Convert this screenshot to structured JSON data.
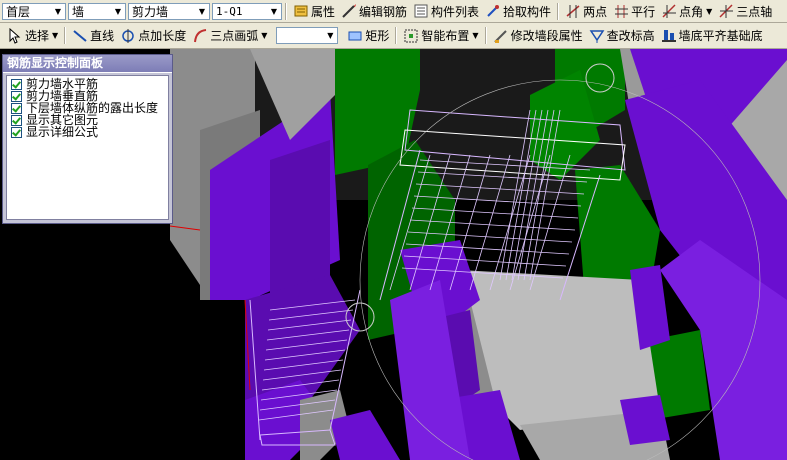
{
  "toolbar1": {
    "floor_select": "首层",
    "type_select": "墙",
    "subtype_select": "剪力墙",
    "element_select": "1-Q1",
    "buttons": [
      "属性",
      "编辑钢筋",
      "构件列表",
      "拾取构件",
      "两点",
      "平行",
      "点角",
      "三点轴"
    ]
  },
  "toolbar2": {
    "select_label": "选择",
    "line_label": "直线",
    "point_length_label": "点加长度",
    "arc_label": "三点画弧",
    "empty_select": "",
    "rect_label": "矩形",
    "smart_layout_label": "智能布置",
    "modify_segment_label": "修改墙段属性",
    "check_elevation_label": "查改标高",
    "align_base_label": "墙底平齐基础底"
  },
  "panel": {
    "title": "钢筋显示控制面板",
    "items": [
      "剪力墙水平筋",
      "剪力墙垂直筋",
      "下层墙体纵筋的露出长度",
      "显示其它图元",
      "显示详细公式"
    ]
  },
  "colors": {
    "purple": "#6a0fd0",
    "green": "#007a00",
    "gray": "#8c8c8c",
    "light_gray": "#bdbdbd",
    "rebar": "#d8b8ff"
  }
}
